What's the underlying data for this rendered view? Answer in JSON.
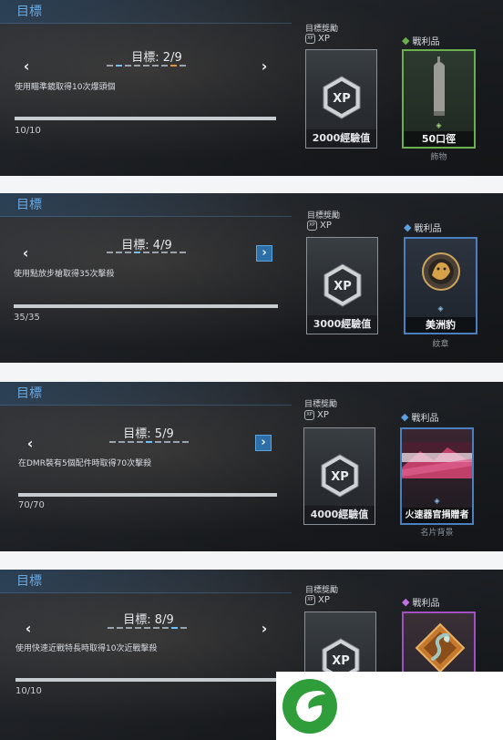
{
  "section_title": "目標",
  "reward_header": "目標獎勵",
  "xp_label": "XP",
  "loot_label": "戰利品",
  "panels": [
    {
      "objective": "目標:  2/9",
      "description": "使用瞄準鏡取得10次爆頭個",
      "progress_text": "10/10",
      "progress": 1.0,
      "xp_reward": "2000經驗值",
      "loot_name": "50口徑",
      "loot_type": "飾物",
      "loot_color": "#6ab04c",
      "pager_total": 9,
      "pager_current": 2
    },
    {
      "objective": "目標:  4/9",
      "description": "使用點放步槍取得35次擊殺",
      "progress_text": "35/35",
      "progress": 1.0,
      "xp_reward": "3000經驗值",
      "loot_name": "美洲豹",
      "loot_type": "紋章",
      "loot_color": "#4a7fc0",
      "pager_total": 9,
      "pager_current": 4
    },
    {
      "objective": "目標:  5/9",
      "description": "在DMR裝有5個配件時取得70次擊殺",
      "progress_text": "70/70",
      "progress": 1.0,
      "xp_reward": "4000經驗值",
      "loot_name": "火速器官捐贈者",
      "loot_type": "名片背景",
      "loot_color": "#4a7fc0",
      "pager_total": 9,
      "pager_current": 5
    },
    {
      "objective": "目標:  8/9",
      "description": "使用快速近戰特長時取得10次近戰擊殺",
      "progress_text": "10/10",
      "progress": 1.0,
      "xp_reward": "",
      "loot_name": "",
      "loot_type": "",
      "loot_color": "#a050c0",
      "pager_total": 9,
      "pager_current": 8
    }
  ]
}
